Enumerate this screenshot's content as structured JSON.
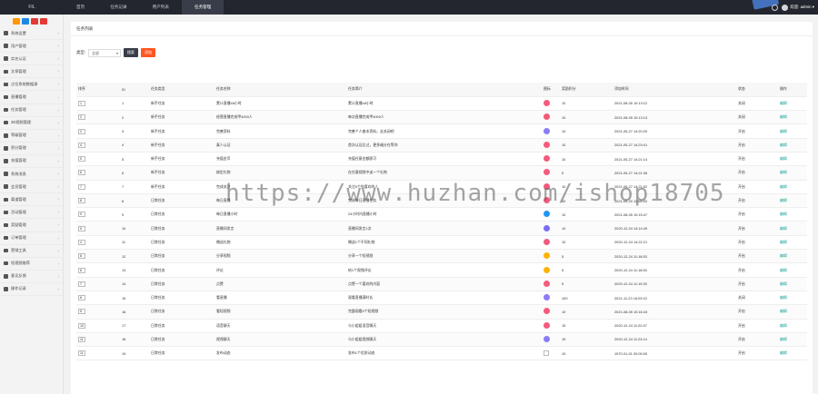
{
  "app": {
    "logo_text": "FIL",
    "top_nav": [
      {
        "label": "首页",
        "active": false
      },
      {
        "label": "任务记录",
        "active": false
      },
      {
        "label": "用户列表",
        "active": false
      },
      {
        "label": "任务管理",
        "active": true
      }
    ],
    "admin_label": "欢迎: admin ▾"
  },
  "sidebar": {
    "quick_colors": [
      "#ff9800",
      "#1e88e5",
      "#e53935",
      "#e53935"
    ],
    "items": [
      {
        "label": "系统设置",
        "icon": "gear-icon"
      },
      {
        "label": "用户管理",
        "icon": "users-icon"
      },
      {
        "label": "实名认证",
        "icon": "id-card-icon"
      },
      {
        "label": "文章管理",
        "icon": "document-icon"
      },
      {
        "label": "点位系统数据源",
        "icon": "chart-icon"
      },
      {
        "label": "直播管理",
        "icon": "video-icon"
      },
      {
        "label": "任务管理",
        "icon": "task-icon"
      },
      {
        "label": "3D视频管理",
        "icon": "film-icon"
      },
      {
        "label": "等级管理",
        "icon": "sitemap-icon"
      },
      {
        "label": "积分管理",
        "icon": "coin-icon"
      },
      {
        "label": "充值管理",
        "icon": "lock-icon"
      },
      {
        "label": "系统消息",
        "icon": "bell-icon"
      },
      {
        "label": "会员管理",
        "icon": "member-icon"
      },
      {
        "label": "渠道管理",
        "icon": "channel-icon"
      },
      {
        "label": "活动管理",
        "icon": "bulb-icon"
      },
      {
        "label": "奖励管理",
        "icon": "location-icon"
      },
      {
        "label": "订单管理",
        "icon": "order-icon"
      },
      {
        "label": "营销工具",
        "icon": "bag-icon"
      },
      {
        "label": "短视频推荐",
        "icon": "chat-icon"
      },
      {
        "label": "意见反馈",
        "icon": "compass-icon"
      },
      {
        "label": "操作记录",
        "icon": "edit-icon"
      }
    ]
  },
  "page": {
    "card_title": "任务列表",
    "filter_label": "类型:",
    "filter_value": "全部",
    "search_label": "搜索",
    "add_label": "添加"
  },
  "table": {
    "headers": [
      "排序",
      "ID",
      "任务类型",
      "任务名称",
      "任务简介",
      "图标",
      "奖励积分",
      "添加时间",
      "状态",
      "操作"
    ],
    "rows": [
      {
        "sort": "1",
        "id": "1",
        "type": "新手任务",
        "name": "累计直播48小时",
        "intro": "累计直播48小时",
        "icon_color": "#f45b7a",
        "points": "10",
        "time": "2021-08-05 10:13:12",
        "status": "关闭",
        "action": "编辑"
      },
      {
        "sort": "2",
        "id": "2",
        "type": "新手任务",
        "name": "经营直播完成甲4000人",
        "intro": "每次直播完成甲4000人",
        "icon_color": "#f45b7a",
        "points": "10",
        "time": "2021-08-05 10:13:13",
        "status": "关闭",
        "action": "编辑"
      },
      {
        "sort": "3",
        "id": "3",
        "type": "新手任务",
        "name": "完善资料",
        "intro": "完善个人基本资料，去关闭吧",
        "icon_color": "#8b7cf6",
        "points": "10",
        "time": "2021-05-27 14:20:20",
        "status": "开启",
        "action": "编辑"
      },
      {
        "sort": "4",
        "id": "4",
        "type": "新手任务",
        "name": "真人认证",
        "intro": "首次认证后过，更多福分在等你",
        "icon_color": "#f45b7a",
        "points": "10",
        "time": "2021-05-27 14:23:41",
        "status": "开启",
        "action": "编辑"
      },
      {
        "sort": "5",
        "id": "5",
        "type": "新手任务",
        "name": "充值金币",
        "intro": "充值任意金额即可",
        "icon_color": "#f45b7a",
        "points": "10",
        "time": "2021-05-27 14:21:14",
        "status": "开启",
        "action": "编辑"
      },
      {
        "sort": "6",
        "id": "6",
        "type": "新手任务",
        "name": "绑定礼物",
        "intro": "在任意视频中送一个礼物",
        "icon_color": "#f45b7a",
        "points": "5",
        "time": "2021-05-27 14:21:35",
        "status": "开启",
        "action": "编辑"
      },
      {
        "sort": "7",
        "id": "7",
        "type": "新手任务",
        "name": "完成关注",
        "intro": "关注5个你喜欢的人",
        "icon_color": "#f45b7a",
        "points": "10",
        "time": "2021-05-27 14:21:52",
        "status": "开启",
        "action": "编辑"
      },
      {
        "sort": "8",
        "id": "8",
        "type": "日常任务",
        "name": "每日直播",
        "intro": "完成每日直播任务",
        "icon_color": "#f45b7a",
        "points": "10",
        "time": "2021-05-20 11:05:53",
        "status": "开启",
        "action": "编辑"
      },
      {
        "sort": "9",
        "id": "9",
        "type": "日常任务",
        "name": "每日直播小时",
        "intro": "24小时内直播小时",
        "icon_color": "#2196f3",
        "points": "10",
        "time": "2021-08-05 10:15:47",
        "status": "开启",
        "action": "编辑"
      },
      {
        "sort": "9",
        "id": "10",
        "type": "日常任务",
        "name": "直播间发言",
        "intro": "直播间发言1次",
        "icon_color": "#7e6cf6",
        "points": "10",
        "time": "2020-12-24 14:14:49",
        "status": "开启",
        "action": "编辑"
      },
      {
        "sort": "4",
        "id": "11",
        "type": "日常任务",
        "name": "赠送礼物",
        "intro": "赠送1个不同礼物",
        "icon_color": "#f45b7a",
        "points": "10",
        "time": "2020-12-24 14:22:21",
        "status": "开启",
        "action": "编辑"
      },
      {
        "sort": "8",
        "id": "12",
        "type": "日常任务",
        "name": "分享视频",
        "intro": "分享一个短视频",
        "icon_color": "#ffb300",
        "points": "5",
        "time": "2020-12-24 11:18:53",
        "status": "开启",
        "action": "编辑"
      },
      {
        "sort": "8",
        "id": "13",
        "type": "日常任务",
        "name": "评论",
        "intro": "给1个视频评论",
        "icon_color": "#ffb300",
        "points": "5",
        "time": "2020-12-24 11:18:53",
        "status": "开启",
        "action": "编辑"
      },
      {
        "sort": "7",
        "id": "14",
        "type": "日常任务",
        "name": "点赞",
        "intro": "点赞一个喜欢的内容",
        "icon_color": "#f45b7a",
        "points": "5",
        "time": "2020-12-24 11:19:33",
        "status": "开启",
        "action": "编辑"
      },
      {
        "sort": "8",
        "id": "15",
        "type": "日常任务",
        "name": "看直播",
        "intro": "观看直播满时长",
        "icon_color": "#8b7cf6",
        "points": "100",
        "time": "2021-11-23 16:03:10",
        "status": "关闭",
        "action": "编辑"
      },
      {
        "sort": "5",
        "id": "16",
        "type": "日常任务",
        "name": "看短视频",
        "intro": "完整观看5个短视频",
        "icon_color": "#f45b7a",
        "points": "10",
        "time": "2021-08-05 10:16:43",
        "status": "开启",
        "action": "编辑"
      },
      {
        "sort": "10",
        "id": "17",
        "type": "日常任务",
        "name": "语音聊天",
        "intro": "与小姐姐语音聊天",
        "icon_color": "#f45b7a",
        "points": "15",
        "time": "2020-12-24 11:22:47",
        "status": "开启",
        "action": "编辑"
      },
      {
        "sort": "11",
        "id": "18",
        "type": "日常任务",
        "name": "视频聊天",
        "intro": "与小姐姐视频聊天",
        "icon_color": "#8b7cf6",
        "points": "15",
        "time": "2020-12-24 11:23:14",
        "status": "开启",
        "action": "编辑"
      },
      {
        "sort": "11",
        "id": "19",
        "type": "日常任务",
        "name": "发布动态",
        "intro": "发布1个优质动态",
        "icon_color": "",
        "points": "10",
        "time": "1970-01-01 00:00:00",
        "status": "开启",
        "action": "编辑"
      }
    ]
  },
  "watermark": "https://www.huzhan.com/ishop18705"
}
